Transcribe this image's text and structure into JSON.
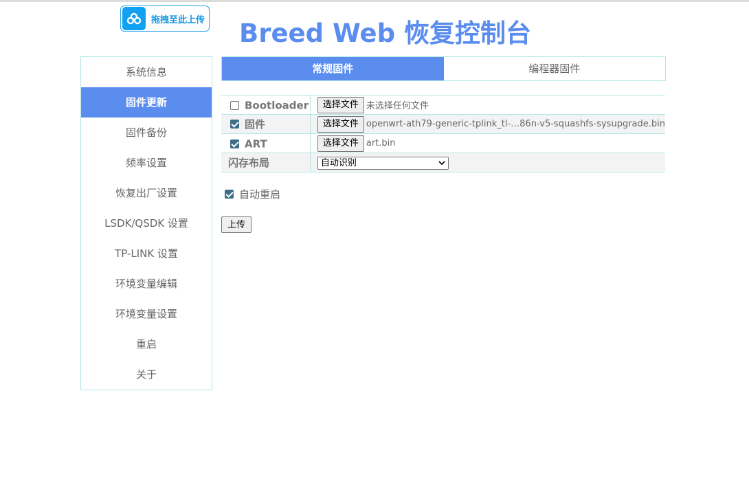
{
  "header": {
    "upload_badge_label": "拖拽至此上传",
    "title": "Breed Web 恢复控制台"
  },
  "sidebar": {
    "items": [
      {
        "label": "系统信息",
        "active": false
      },
      {
        "label": "固件更新",
        "active": true
      },
      {
        "label": "固件备份",
        "active": false
      },
      {
        "label": "频率设置",
        "active": false
      },
      {
        "label": "恢复出厂设置",
        "active": false
      },
      {
        "label": "LSDK/QSDK 设置",
        "active": false
      },
      {
        "label": "TP-LINK 设置",
        "active": false
      },
      {
        "label": "环境变量编辑",
        "active": false
      },
      {
        "label": "环境变量设置",
        "active": false
      },
      {
        "label": "重启",
        "active": false
      },
      {
        "label": "关于",
        "active": false
      }
    ]
  },
  "tabs": [
    {
      "label": "常规固件",
      "active": true
    },
    {
      "label": "编程器固件",
      "active": false
    }
  ],
  "form": {
    "rows": [
      {
        "label": "Bootloader",
        "checked": false,
        "button": "选择文件",
        "file": "未选择任何文件"
      },
      {
        "label": "固件",
        "checked": true,
        "button": "选择文件",
        "file": "openwrt-ath79-generic-tplink_tl-…86n-v5-squashfs-sysupgrade.bin"
      },
      {
        "label": "ART",
        "checked": true,
        "button": "选择文件",
        "file": "art.bin"
      }
    ],
    "flash_layout": {
      "label": "闪存布局",
      "selected": "自动识别"
    },
    "auto_reboot": {
      "label": "自动重启",
      "checked": true
    },
    "submit_label": "上传"
  },
  "colors": {
    "accent": "#5b8def",
    "border": "#b3e6e6",
    "checkbox": "#3f6c87"
  }
}
